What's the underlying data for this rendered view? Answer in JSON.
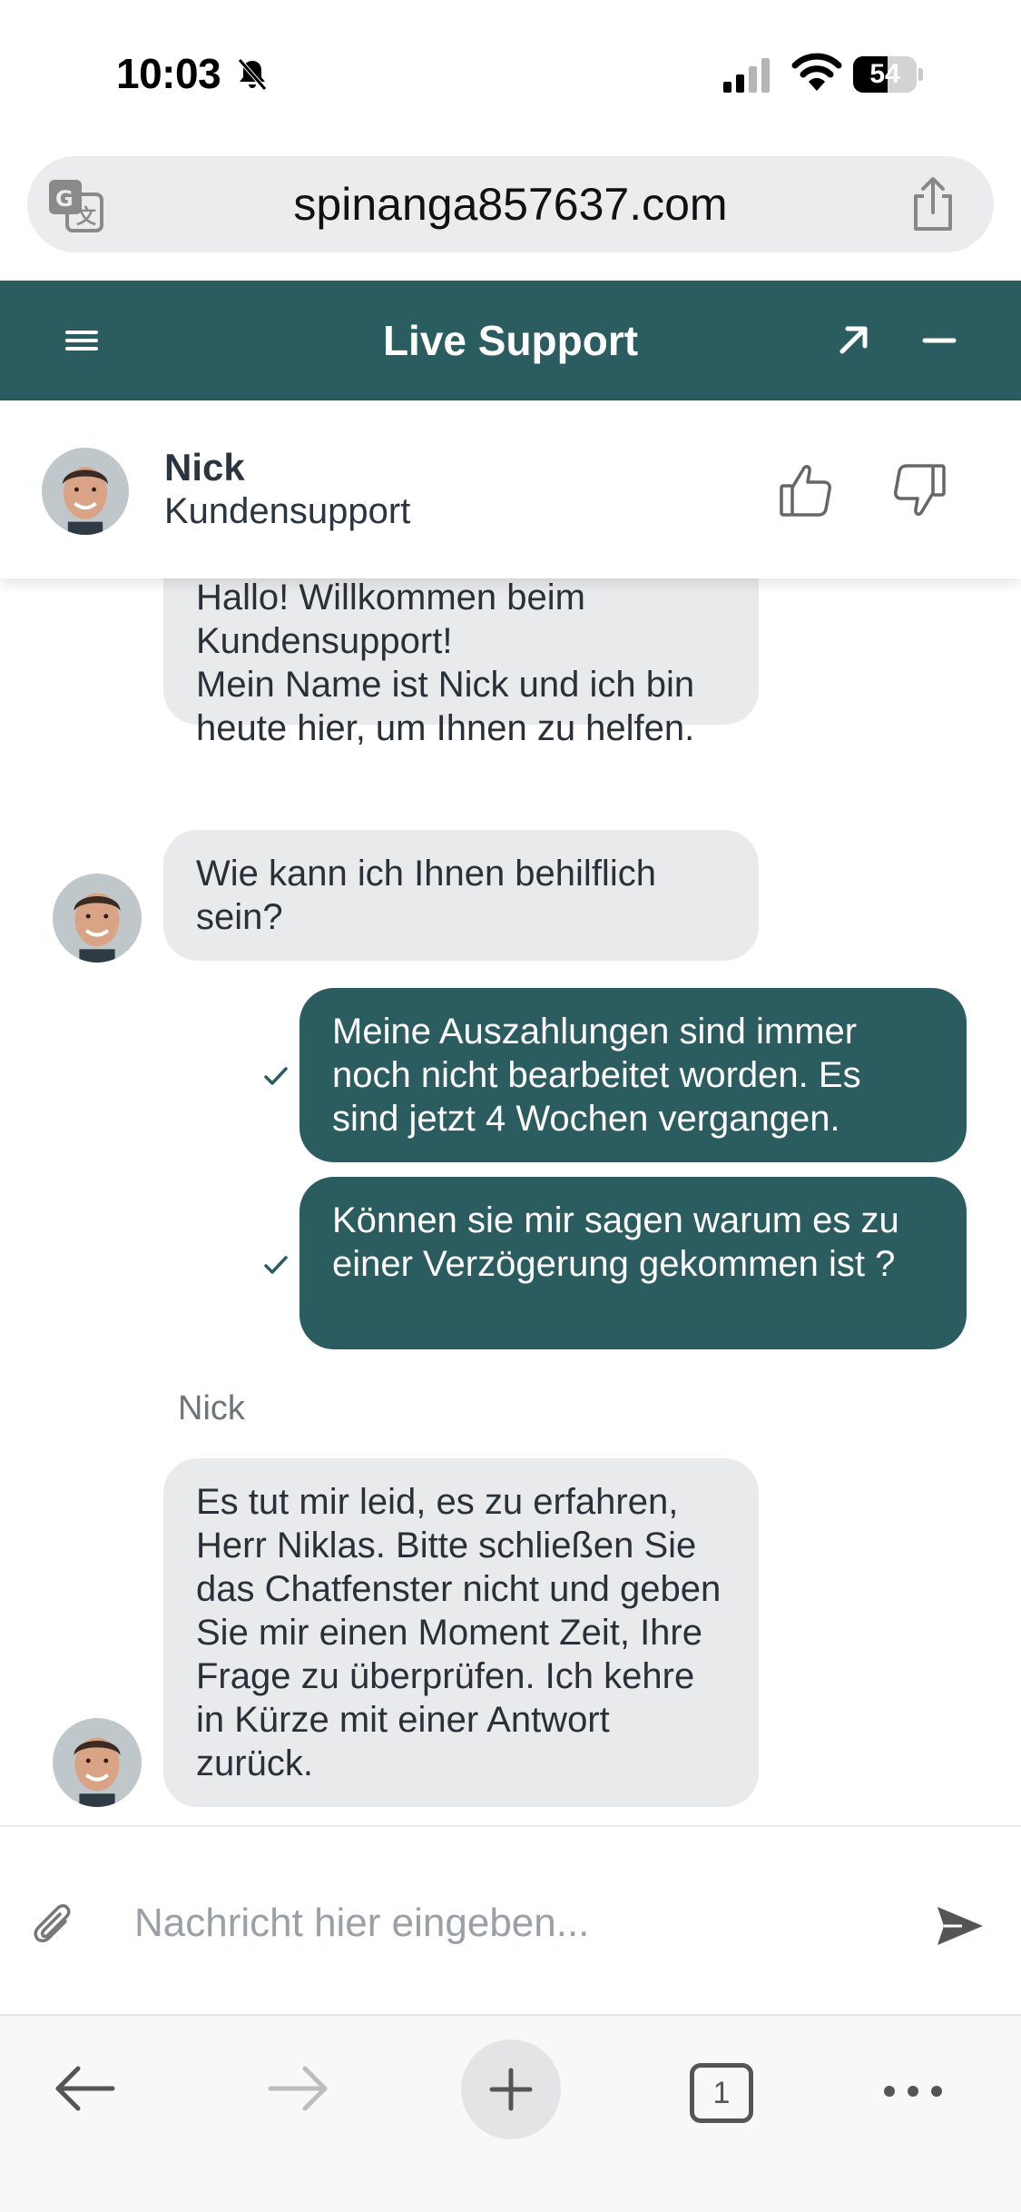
{
  "status_bar": {
    "time": "10:03",
    "battery_level": "54",
    "battery_fraction": 0.54,
    "icons": [
      "bell-slash-icon",
      "cellular-signal-icon",
      "wifi-icon",
      "battery-icon"
    ]
  },
  "browser": {
    "url": "spinanga857637.com",
    "icons": [
      "translate-icon",
      "share-icon"
    ]
  },
  "chat_header": {
    "title": "Live Support",
    "icons": [
      "menu-icon",
      "expand-icon",
      "minimize-icon"
    ],
    "color": "#2b5c60"
  },
  "agent": {
    "name": "Nick",
    "role": "Kundensupport",
    "icons": [
      "thumb-up-icon",
      "thumb-down-icon"
    ]
  },
  "messages": [
    {
      "from": "agent",
      "text": "Hallo! Willkommen beim Kundensupport!\nMein Name ist Nick und ich bin heute hier, um Ihnen zu helfen."
    },
    {
      "from": "agent",
      "text": "Wie kann ich Ihnen behilflich sein?"
    },
    {
      "from": "user",
      "text": "Meine Auszahlungen sind immer noch nicht bearbeitet worden. Es sind jetzt 4 Wochen vergangen.",
      "status_icon": "check-icon"
    },
    {
      "from": "user",
      "text": "Können sie mir sagen warum es zu einer Verzögerung gekommen ist ?",
      "status_icon": "check-icon"
    },
    {
      "from": "agent",
      "sender": "Nick",
      "text": "Es tut mir leid, es zu erfahren, Herr Niklas. Bitte schließen Sie das Chatfenster nicht und geben Sie mir einen Moment Zeit, Ihre Frage zu überprüfen. Ich kehre in Kürze mit einer Antwort zurück."
    }
  ],
  "composer": {
    "placeholder": "Nachricht hier eingeben...",
    "value": "",
    "icons": [
      "paperclip-icon",
      "send-icon"
    ]
  },
  "toolbar": {
    "tab_count": "1",
    "icons": [
      "back-arrow-icon",
      "forward-arrow-icon",
      "plus-icon",
      "tabs-icon",
      "more-icon"
    ]
  },
  "colors": {
    "accent": "#2b5c60",
    "agent_bubble": "#e9eaec",
    "user_bubble": "#2b5c60"
  }
}
